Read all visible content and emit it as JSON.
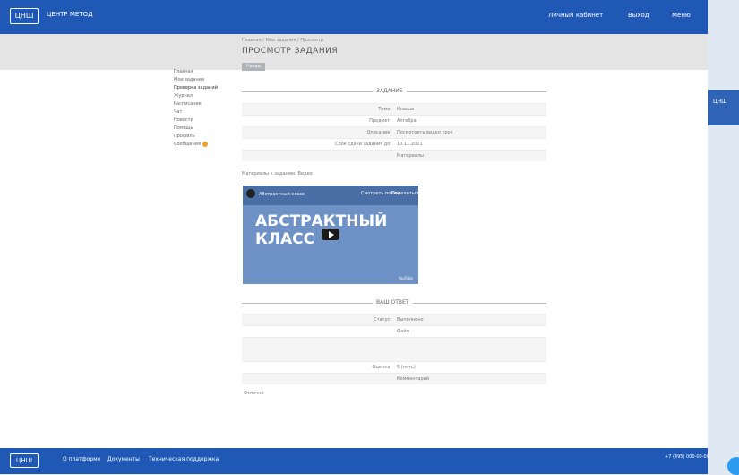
{
  "topbar": {
    "logo": "ЦНШ",
    "brand": "ЦЕНТР МЕТОД",
    "links": [
      "Личный кабинет",
      "Выход",
      "Меню"
    ]
  },
  "breadcrumb": "Главная / Мои задания / Просмотр",
  "page_title": "ПРОСМОТР ЗАДАНИЯ",
  "back_button": "Назад",
  "sidebar": {
    "items": [
      "Главная",
      "Мои задания",
      "Проверка заданий",
      "Журнал",
      "Расписание",
      "Чат",
      "Новости",
      "Помощь",
      "Профиль",
      "Сообщения"
    ]
  },
  "task_section": {
    "title": "ЗАДАНИЕ",
    "rows": [
      {
        "k": "Тема:",
        "v": "Классы"
      },
      {
        "k": "Предмет:",
        "v": "Алгебра"
      },
      {
        "k": "Описание:",
        "v": "Посмотреть видео урок"
      },
      {
        "k": "Срок сдачи задания до:",
        "v": "10.11.2021"
      },
      {
        "k": "",
        "v": "Материалы"
      }
    ]
  },
  "note": "Материалы к заданию: Видео",
  "video": {
    "title": "Абстрактный класс",
    "big_text_1": "АБСТРАКТНЫЙ",
    "big_text_2": "КЛАСС",
    "watch_later": "Смотреть позже",
    "share": "Поделиться",
    "footer": "YouTube"
  },
  "answer_section": {
    "title": "ВАШ ОТВЕТ",
    "rows": [
      {
        "k": "Статус:",
        "v": "Выполнено"
      },
      {
        "k": "",
        "v": "Файл"
      },
      {
        "k": "",
        "v": ""
      },
      {
        "k": "Оценка:",
        "v": "5 (пять)"
      },
      {
        "k": "",
        "v": "Комментарий"
      }
    ]
  },
  "bottom_note": "Отлично",
  "footer": {
    "logo": "ЦНШ",
    "links": [
      "О платформе",
      "Документы",
      "Техническая поддержка"
    ],
    "right": "+7 (495) 000-00-00"
  },
  "outside": "ЦНШ"
}
